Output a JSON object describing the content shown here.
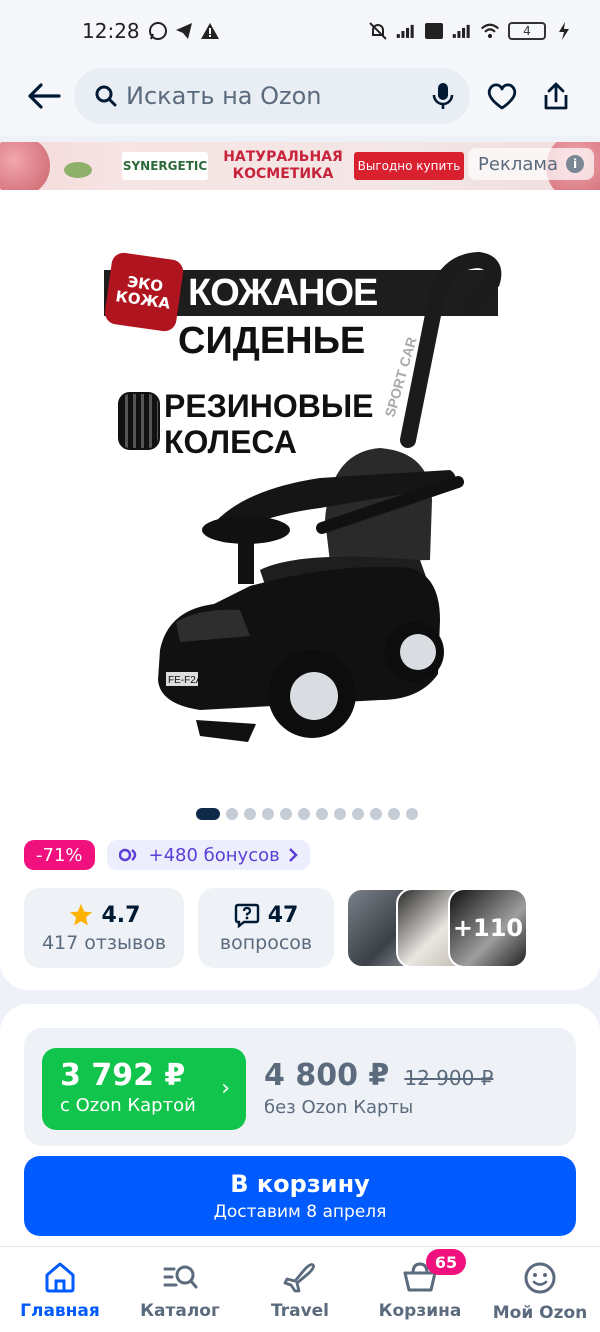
{
  "status_bar": {
    "time": "12:28",
    "battery": "4"
  },
  "header": {
    "search_placeholder": "Искать на Ozon"
  },
  "ad": {
    "brand": "SYNERGETIC",
    "headline": "НАТУРАЛЬНАЯ КОСМЕТИКА",
    "cta": "Выгодно купить",
    "tag": "Реклама"
  },
  "product": {
    "promo_badge_line1": "ЭКО",
    "promo_badge_line2": "КОЖА",
    "promo_line1": "КОЖАНОЕ",
    "promo_line2": "СИДЕНЬЕ",
    "promo_line3": "РЕЗИНОВЫЕ",
    "promo_line4": "КОЛЕСА",
    "toy_label": "SPORT CAR",
    "plate": "FE-F2A",
    "gallery": {
      "dots": 12,
      "active_index": 0
    },
    "discount": "-71%",
    "bonus": "+480 бонусов",
    "rating": "4.7",
    "reviews": "417 отзывов",
    "questions_count": "47",
    "questions_label": "вопросов",
    "photos_more": "+110"
  },
  "price": {
    "card_price": "3 792 ₽",
    "card_label": "с Ozon Картой",
    "regular_price": "4 800 ₽",
    "old_price": "12 900 ₽",
    "regular_label": "без Ozon Карты"
  },
  "cart_button": {
    "label": "В корзину",
    "sub": "Доставим 8 апреля"
  },
  "nav": {
    "items": [
      {
        "label": "Главная",
        "icon": "home-icon"
      },
      {
        "label": "Каталог",
        "icon": "catalog-icon"
      },
      {
        "label": "Travel",
        "icon": "plane-icon"
      },
      {
        "label": "Корзина",
        "icon": "cart-icon",
        "badge": "65"
      },
      {
        "label": "Мой Ozon",
        "icon": "profile-icon"
      }
    ]
  },
  "colors": {
    "accent": "#005bff",
    "green": "#10c44c",
    "pink": "#f1117e",
    "text": "#001a34"
  }
}
